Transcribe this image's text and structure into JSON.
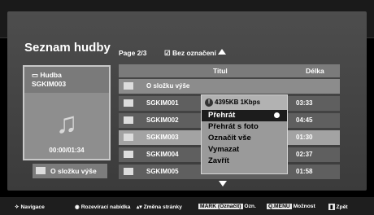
{
  "header": {
    "title": "Seznam hudby",
    "page": "Page 2/3",
    "selection_filter": "Bez označení"
  },
  "left_panel": {
    "folder_name": "Hudba",
    "track": "SGKIM003",
    "time": "00:00/01:34",
    "up_button": "O složku výše"
  },
  "table": {
    "col_title": "Titul",
    "col_length": "Délka",
    "rows": [
      {
        "name": "O složku výše",
        "duration": ""
      },
      {
        "name": "SGKIM001",
        "duration": "03:33"
      },
      {
        "name": "SGKIM002",
        "duration": "04:45"
      },
      {
        "name": "SGKIM003",
        "duration": "01:30"
      },
      {
        "name": "SGKIM004",
        "duration": "02:37"
      },
      {
        "name": "SGKIM005",
        "duration": "01:58"
      }
    ]
  },
  "popup": {
    "info": "4395KB 1Kbps",
    "items": [
      "Přehrát",
      "Přehrát s foto",
      "Označit vše",
      "Vymazat",
      "Zavřít"
    ]
  },
  "footer": {
    "navigace": "Navigace",
    "rozevirat": "Rozevírací nabídka",
    "zmena": "Změna stránky",
    "mark_key": "MARK (Označit)",
    "ozn": "Ozn.",
    "qmenu_key": "Q.MENU",
    "moznost": "Možnost",
    "zpet": "Zpět"
  }
}
